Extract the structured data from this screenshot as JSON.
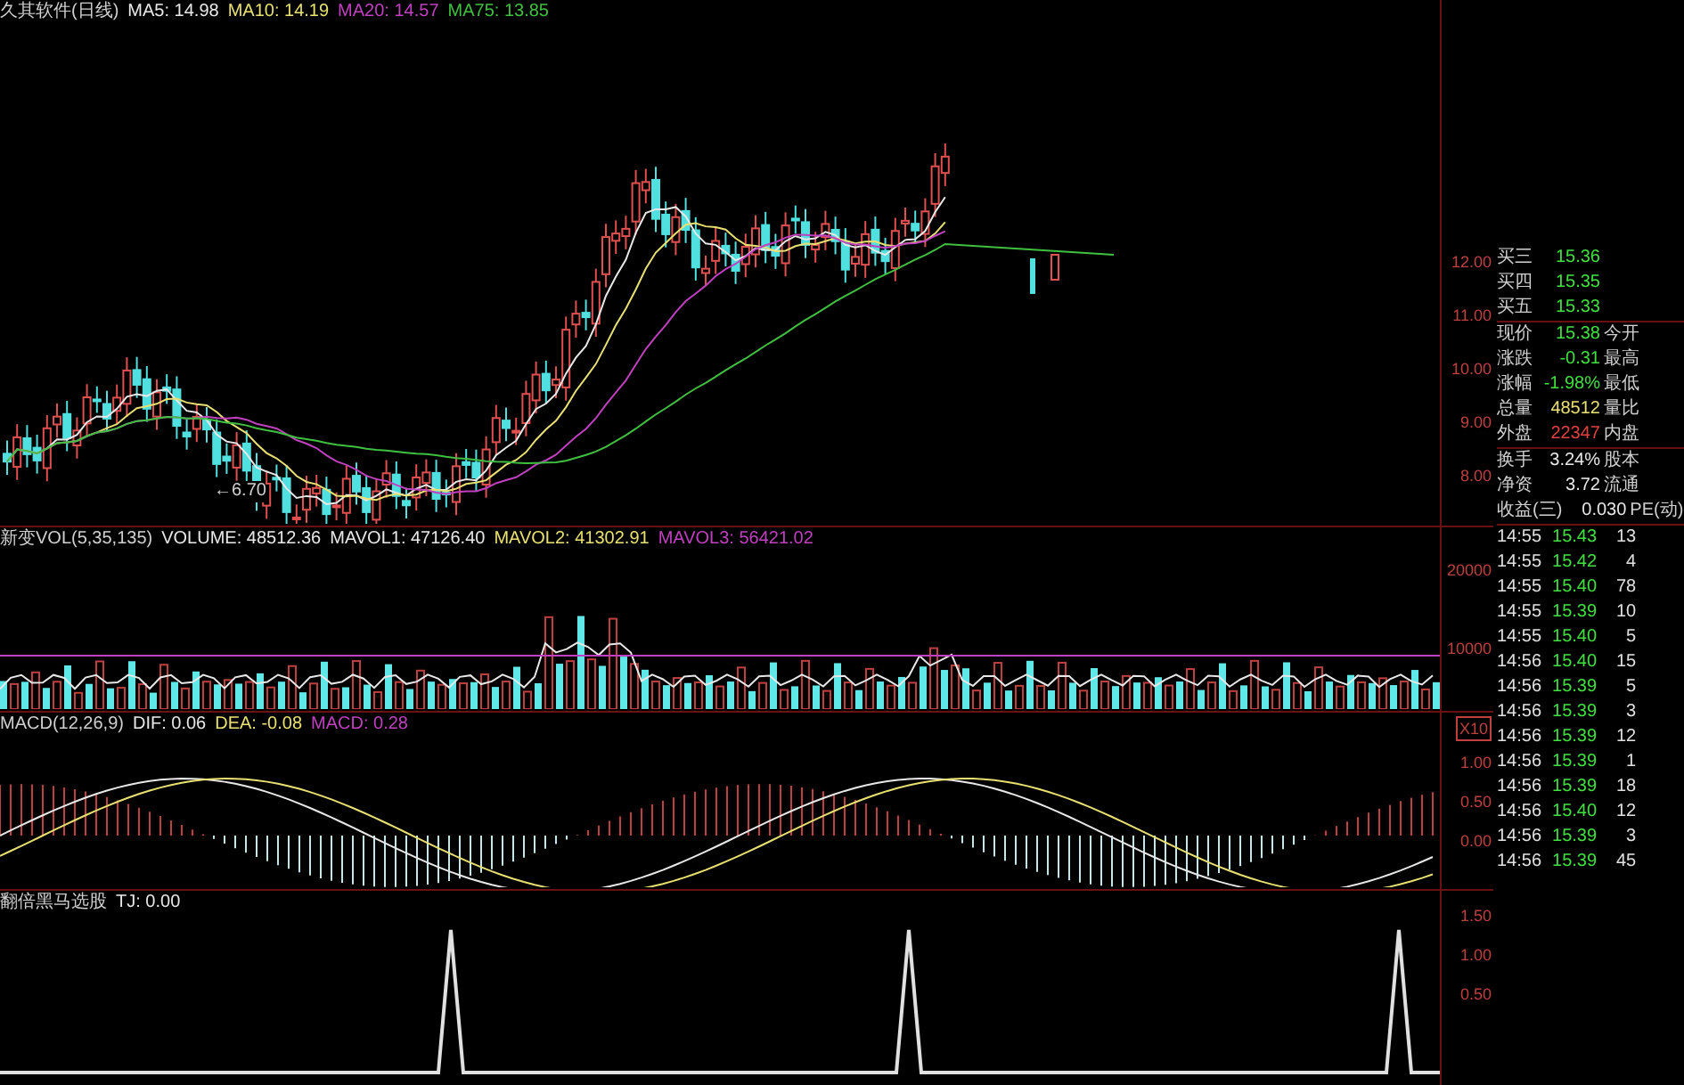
{
  "price_pane": {
    "title": "久其软件(日线)",
    "indicators": [
      {
        "label": "MA5: 14.98",
        "color": "#e8e8e8"
      },
      {
        "label": "MA10: 14.19",
        "color": "#e8e070"
      },
      {
        "label": "MA20: 14.57",
        "color": "#c040c0"
      },
      {
        "label": "MA75: 13.85",
        "color": "#40c040"
      }
    ],
    "low_marker": "←6.70",
    "axis": [
      "12.00",
      "11.00",
      "10.00",
      "9.00",
      "8.00"
    ]
  },
  "volume_pane": {
    "title": "新变VOL(5,35,135)",
    "indicators": [
      {
        "label": "VOLUME: 48512.36",
        "color": "#e8e8e8"
      },
      {
        "label": "MAVOL1: 47126.40",
        "color": "#e8e8e8"
      },
      {
        "label": "MAVOL2: 41302.91",
        "color": "#e8e070"
      },
      {
        "label": "MAVOL3: 56421.02",
        "color": "#c040c0"
      }
    ],
    "axis": [
      "20000",
      "10000"
    ],
    "unit": "X10"
  },
  "macd_pane": {
    "title": "MACD(12,26,9)",
    "indicators": [
      {
        "label": "DIF: 0.06",
        "color": "#e8e8e8"
      },
      {
        "label": "DEA: -0.08",
        "color": "#e8e070"
      },
      {
        "label": "MACD: 0.28",
        "color": "#c040c0"
      }
    ],
    "axis": [
      "1.00",
      "0.50",
      "0.00"
    ]
  },
  "signal_pane": {
    "title": "翻倍黑马选股",
    "indicators": [
      {
        "label": "TJ: 0.00",
        "color": "#e8e8e8"
      }
    ],
    "axis": [
      "1.50",
      "1.00",
      "0.50"
    ]
  },
  "quote": [
    {
      "label": "买三",
      "value": "15.36",
      "color": "#40e040"
    },
    {
      "label": "买四",
      "value": "15.35",
      "color": "#40e040"
    },
    {
      "label": "买五",
      "value": "15.33",
      "color": "#40e040"
    },
    {
      "label": "现价",
      "value": "15.38",
      "label2": "今开",
      "color": "#40e040"
    },
    {
      "label": "涨跌",
      "value": "-0.31",
      "label2": "最高",
      "color": "#40e040"
    },
    {
      "label": "涨幅",
      "value": "-1.98%",
      "label2": "最低",
      "color": "#40e040"
    },
    {
      "label": "总量",
      "value": "48512",
      "label2": "量比",
      "color": "#e8e070"
    },
    {
      "label": "外盘",
      "value": "22347",
      "label2": "内盘",
      "color": "#e04040"
    },
    {
      "label": "换手",
      "value": "3.24%",
      "label2": "股本",
      "color": "#e8e8e8"
    },
    {
      "label": "净资",
      "value": "3.72",
      "label2": "流通",
      "color": "#e8e8e8"
    },
    {
      "label": "收益(三)",
      "value": "0.030",
      "label2": "PE(动)",
      "color": "#e8e8e8"
    }
  ],
  "ticks": [
    {
      "time": "14:55",
      "price": "15.43",
      "volume": "13"
    },
    {
      "time": "14:55",
      "price": "15.42",
      "volume": "4"
    },
    {
      "time": "14:55",
      "price": "15.40",
      "volume": "78"
    },
    {
      "time": "14:55",
      "price": "15.39",
      "volume": "10"
    },
    {
      "time": "14:55",
      "price": "15.40",
      "volume": "5"
    },
    {
      "time": "14:56",
      "price": "15.40",
      "volume": "15"
    },
    {
      "time": "14:56",
      "price": "15.39",
      "volume": "5"
    },
    {
      "time": "14:56",
      "price": "15.39",
      "volume": "3"
    },
    {
      "time": "14:56",
      "price": "15.39",
      "volume": "12"
    },
    {
      "time": "14:56",
      "price": "15.39",
      "volume": "1"
    },
    {
      "time": "14:56",
      "price": "15.39",
      "volume": "18"
    },
    {
      "time": "14:56",
      "price": "15.40",
      "volume": "12"
    },
    {
      "time": "14:56",
      "price": "15.39",
      "volume": "3"
    },
    {
      "time": "14:56",
      "price": "15.39",
      "volume": "45"
    }
  ]
}
